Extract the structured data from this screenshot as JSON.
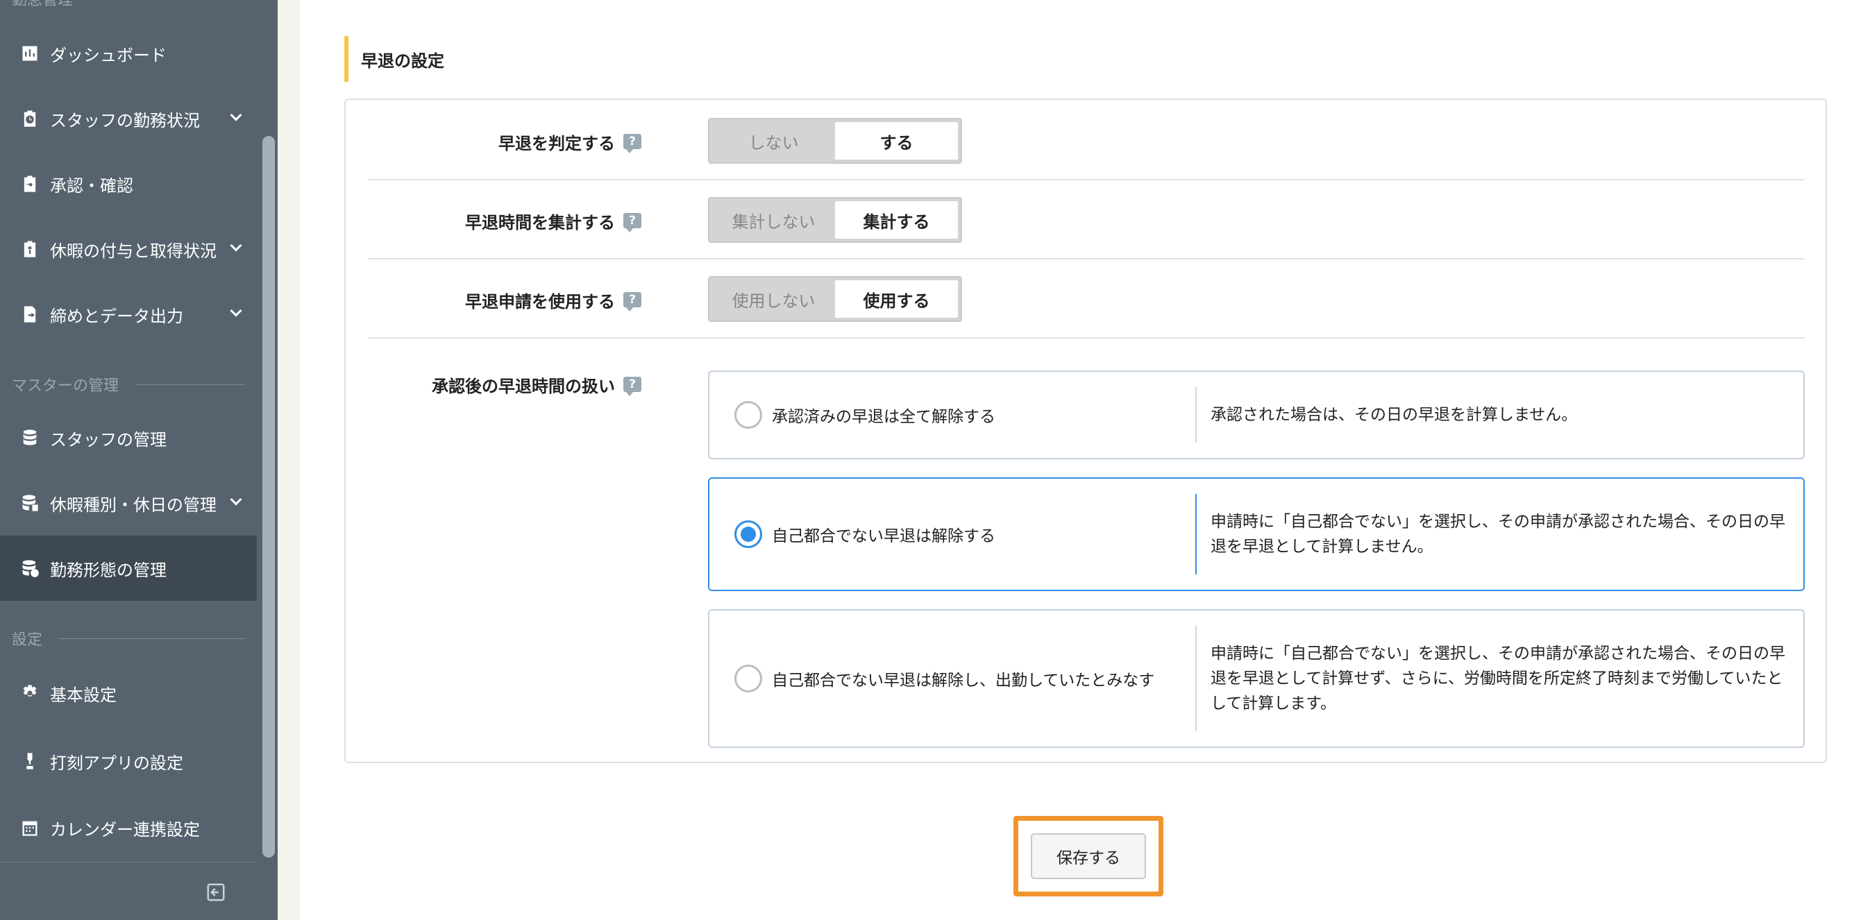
{
  "sidebar": {
    "top_group": "勤怠管理",
    "items": [
      {
        "label": "ダッシュボード",
        "icon": "chart-icon"
      },
      {
        "label": "スタッフの勤務状況",
        "icon": "clock-clipboard-icon"
      },
      {
        "label": "承認・確認",
        "icon": "approval-clipboard-icon"
      },
      {
        "label": "休暇の付与と取得状況",
        "icon": "leave-clipboard-icon"
      },
      {
        "label": "締めとデータ出力",
        "icon": "export-file-icon"
      },
      {
        "label": "スタッフの管理",
        "icon": "database-icon"
      },
      {
        "label": "休暇種別・休日の管理",
        "icon": "database-leave-icon"
      },
      {
        "label": "勤務形態の管理",
        "icon": "database-clock-icon"
      },
      {
        "label": "基本設定",
        "icon": "gear-icon"
      },
      {
        "label": "打刻アプリの設定",
        "icon": "stamp-app-icon"
      },
      {
        "label": "カレンダー連携設定",
        "icon": "calendar-icon"
      }
    ],
    "section_master": "マスターの管理",
    "section_settings": "設定"
  },
  "section_title": "早退の設定",
  "settings": {
    "judge": {
      "label": "早退を判定する",
      "off": "しない",
      "on": "する"
    },
    "aggregate": {
      "label": "早退時間を集計する",
      "off": "集計しない",
      "on": "集計する"
    },
    "request": {
      "label": "早退申請を使用する",
      "off": "使用しない",
      "on": "使用する"
    },
    "handling": {
      "label": "承認後の早退時間の扱い",
      "options": [
        {
          "label": "承認済みの早退は全て解除する",
          "desc": "承認された場合は、その日の早退を計算しません。"
        },
        {
          "label": "自己都合でない早退は解除する",
          "desc": "申請時に「自己都合でない」を選択し、その申請が承認された場合、その日の早退を早退として計算しません。"
        },
        {
          "label": "自己都合でない早退は解除し、出勤していたとみなす",
          "desc": "申請時に「自己都合でない」を選択し、その申請が承認された場合、その日の早退を早退として計算せず、さらに、労働時間を所定終了時刻まで労働していたとして計算します。"
        }
      ]
    }
  },
  "help_glyph": "?",
  "save_label": "保存する",
  "colors": {
    "accent": "#2f8ee5",
    "sidebar": "#56636f",
    "highlight": "#f0952e",
    "title_bar": "#f5c543"
  }
}
